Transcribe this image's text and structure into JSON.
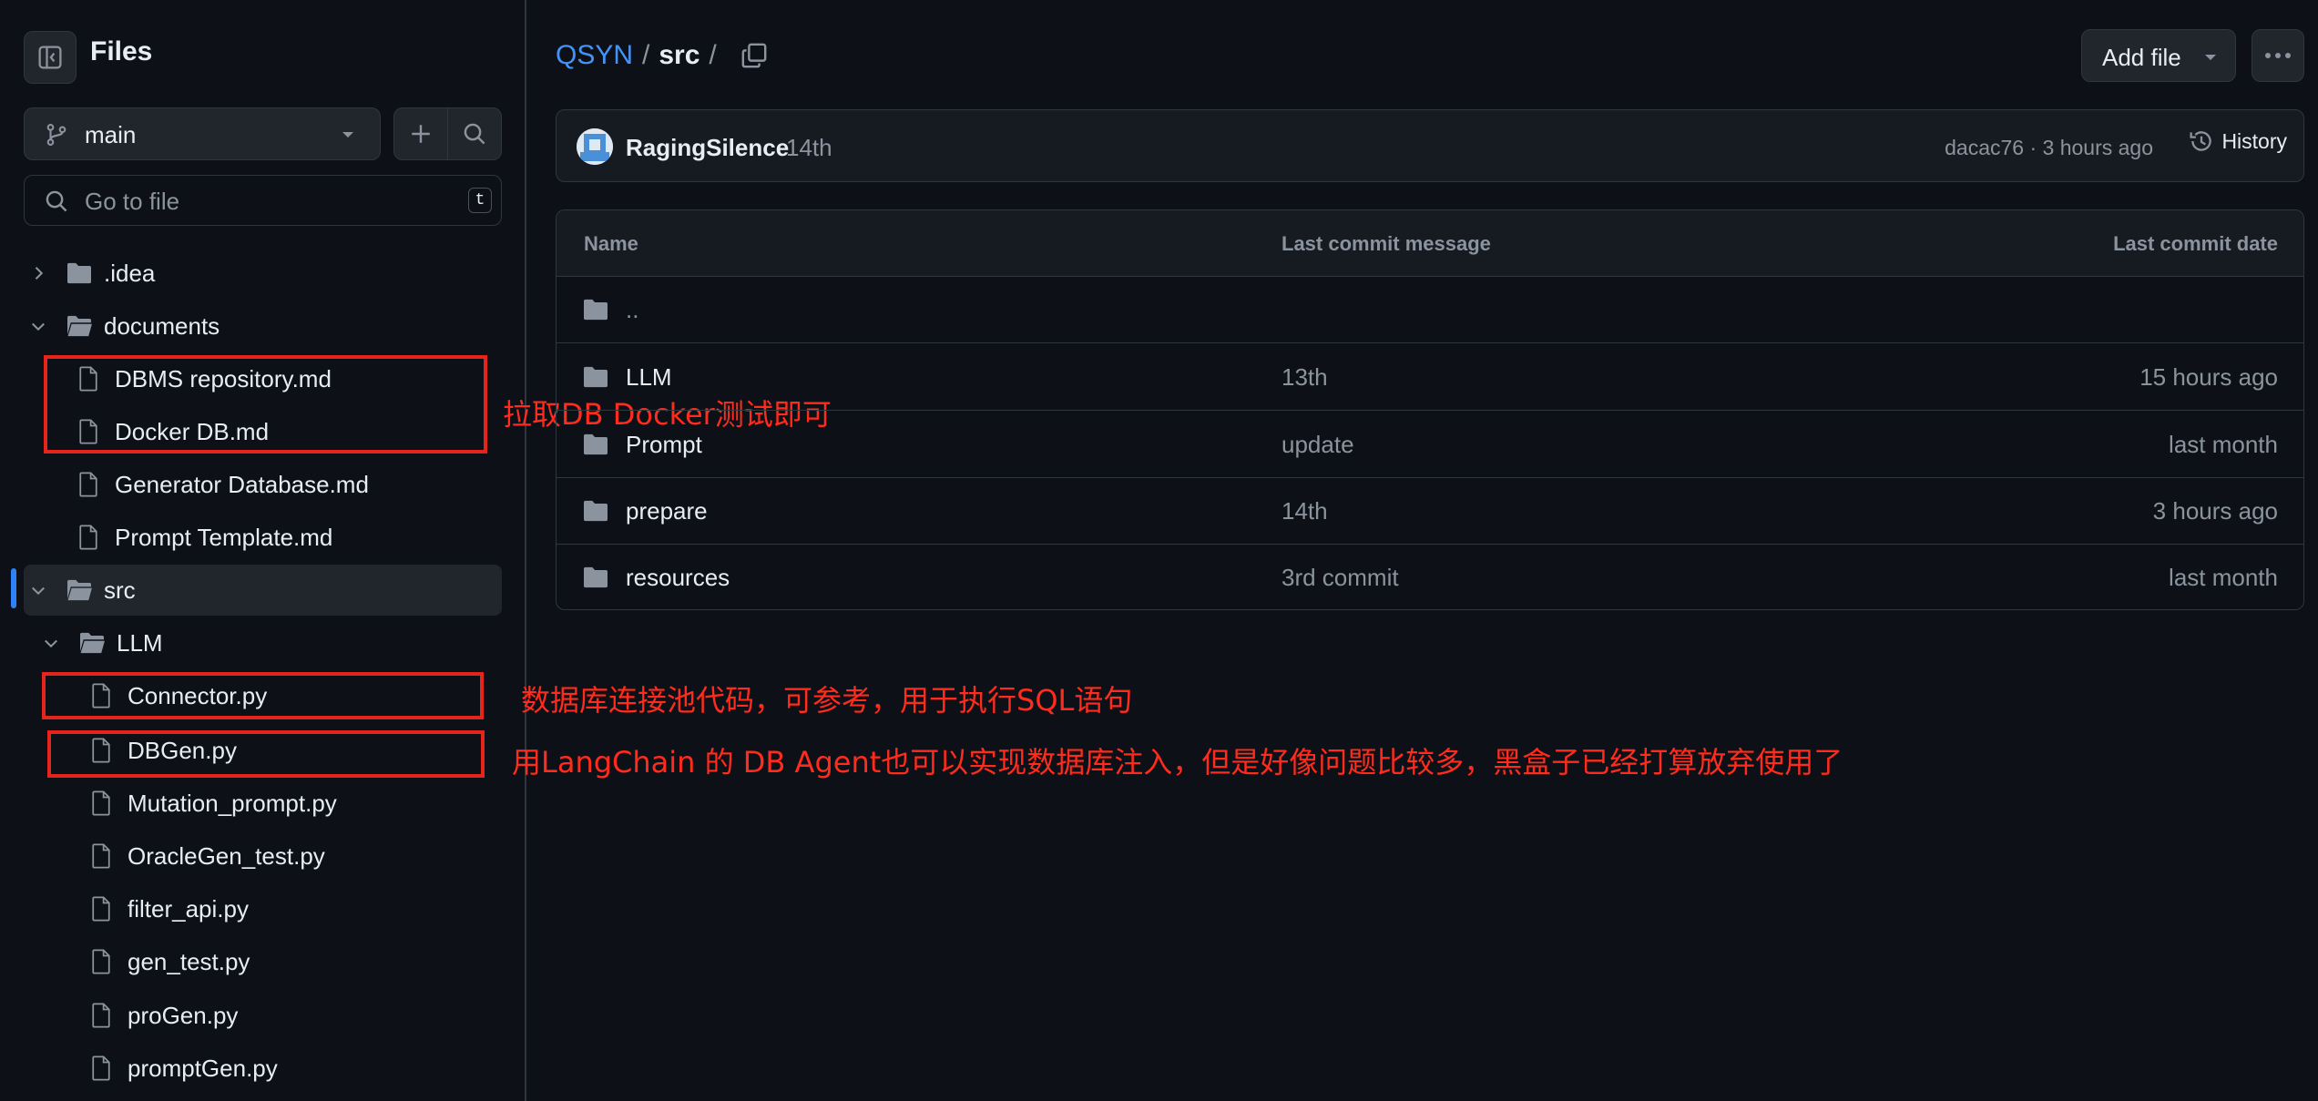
{
  "sidebar": {
    "title": "Files",
    "branch": "main",
    "goto_placeholder": "Go to file",
    "goto_shortcut": "t",
    "tree": [
      {
        "label": ".idea",
        "type": "folder",
        "expanded": false
      },
      {
        "label": "documents",
        "type": "folder",
        "expanded": true
      },
      {
        "label": "DBMS repository.md",
        "type": "file"
      },
      {
        "label": "Docker DB.md",
        "type": "file"
      },
      {
        "label": "Generator Database.md",
        "type": "file"
      },
      {
        "label": "Prompt Template.md",
        "type": "file"
      },
      {
        "label": "src",
        "type": "folder",
        "expanded": true,
        "active": true
      },
      {
        "label": "LLM",
        "type": "folder",
        "expanded": true
      },
      {
        "label": "Connector.py",
        "type": "file"
      },
      {
        "label": "DBGen.py",
        "type": "file"
      },
      {
        "label": "Mutation_prompt.py",
        "type": "file"
      },
      {
        "label": "OracleGen_test.py",
        "type": "file"
      },
      {
        "label": "filter_api.py",
        "type": "file"
      },
      {
        "label": "gen_test.py",
        "type": "file"
      },
      {
        "label": "proGen.py",
        "type": "file"
      },
      {
        "label": "promptGen.py",
        "type": "file"
      }
    ]
  },
  "annotations": {
    "docs_note": "拉取DB Docker测试即可",
    "connector_note": "数据库连接池代码，可参考，用于执行SQL语句",
    "dbgen_note": "用LangChain 的 DB Agent也可以实现数据库注入，但是好像问题比较多，黑盒子已经打算放弃使用了"
  },
  "header": {
    "repo": "QSYN",
    "sep1": "/",
    "current": "src",
    "sep2": "/",
    "add_file": "Add file"
  },
  "commit": {
    "author": "RagingSilence",
    "message": "14th",
    "hash_time": "dacac76 · 3 hours ago",
    "history": "History"
  },
  "table": {
    "col_name": "Name",
    "col_msg": "Last commit message",
    "col_date": "Last commit date",
    "rows": [
      {
        "name": "..",
        "msg": "",
        "date": ""
      },
      {
        "name": "LLM",
        "msg": "13th",
        "date": "15 hours ago"
      },
      {
        "name": "Prompt",
        "msg": "update",
        "date": "last month"
      },
      {
        "name": "prepare",
        "msg": "14th",
        "date": "3 hours ago"
      },
      {
        "name": "resources",
        "msg": "3rd commit",
        "date": "last month"
      }
    ]
  },
  "colors": {
    "background": "#0d1117",
    "link": "#4493f8",
    "annotation": "#e5241b"
  }
}
